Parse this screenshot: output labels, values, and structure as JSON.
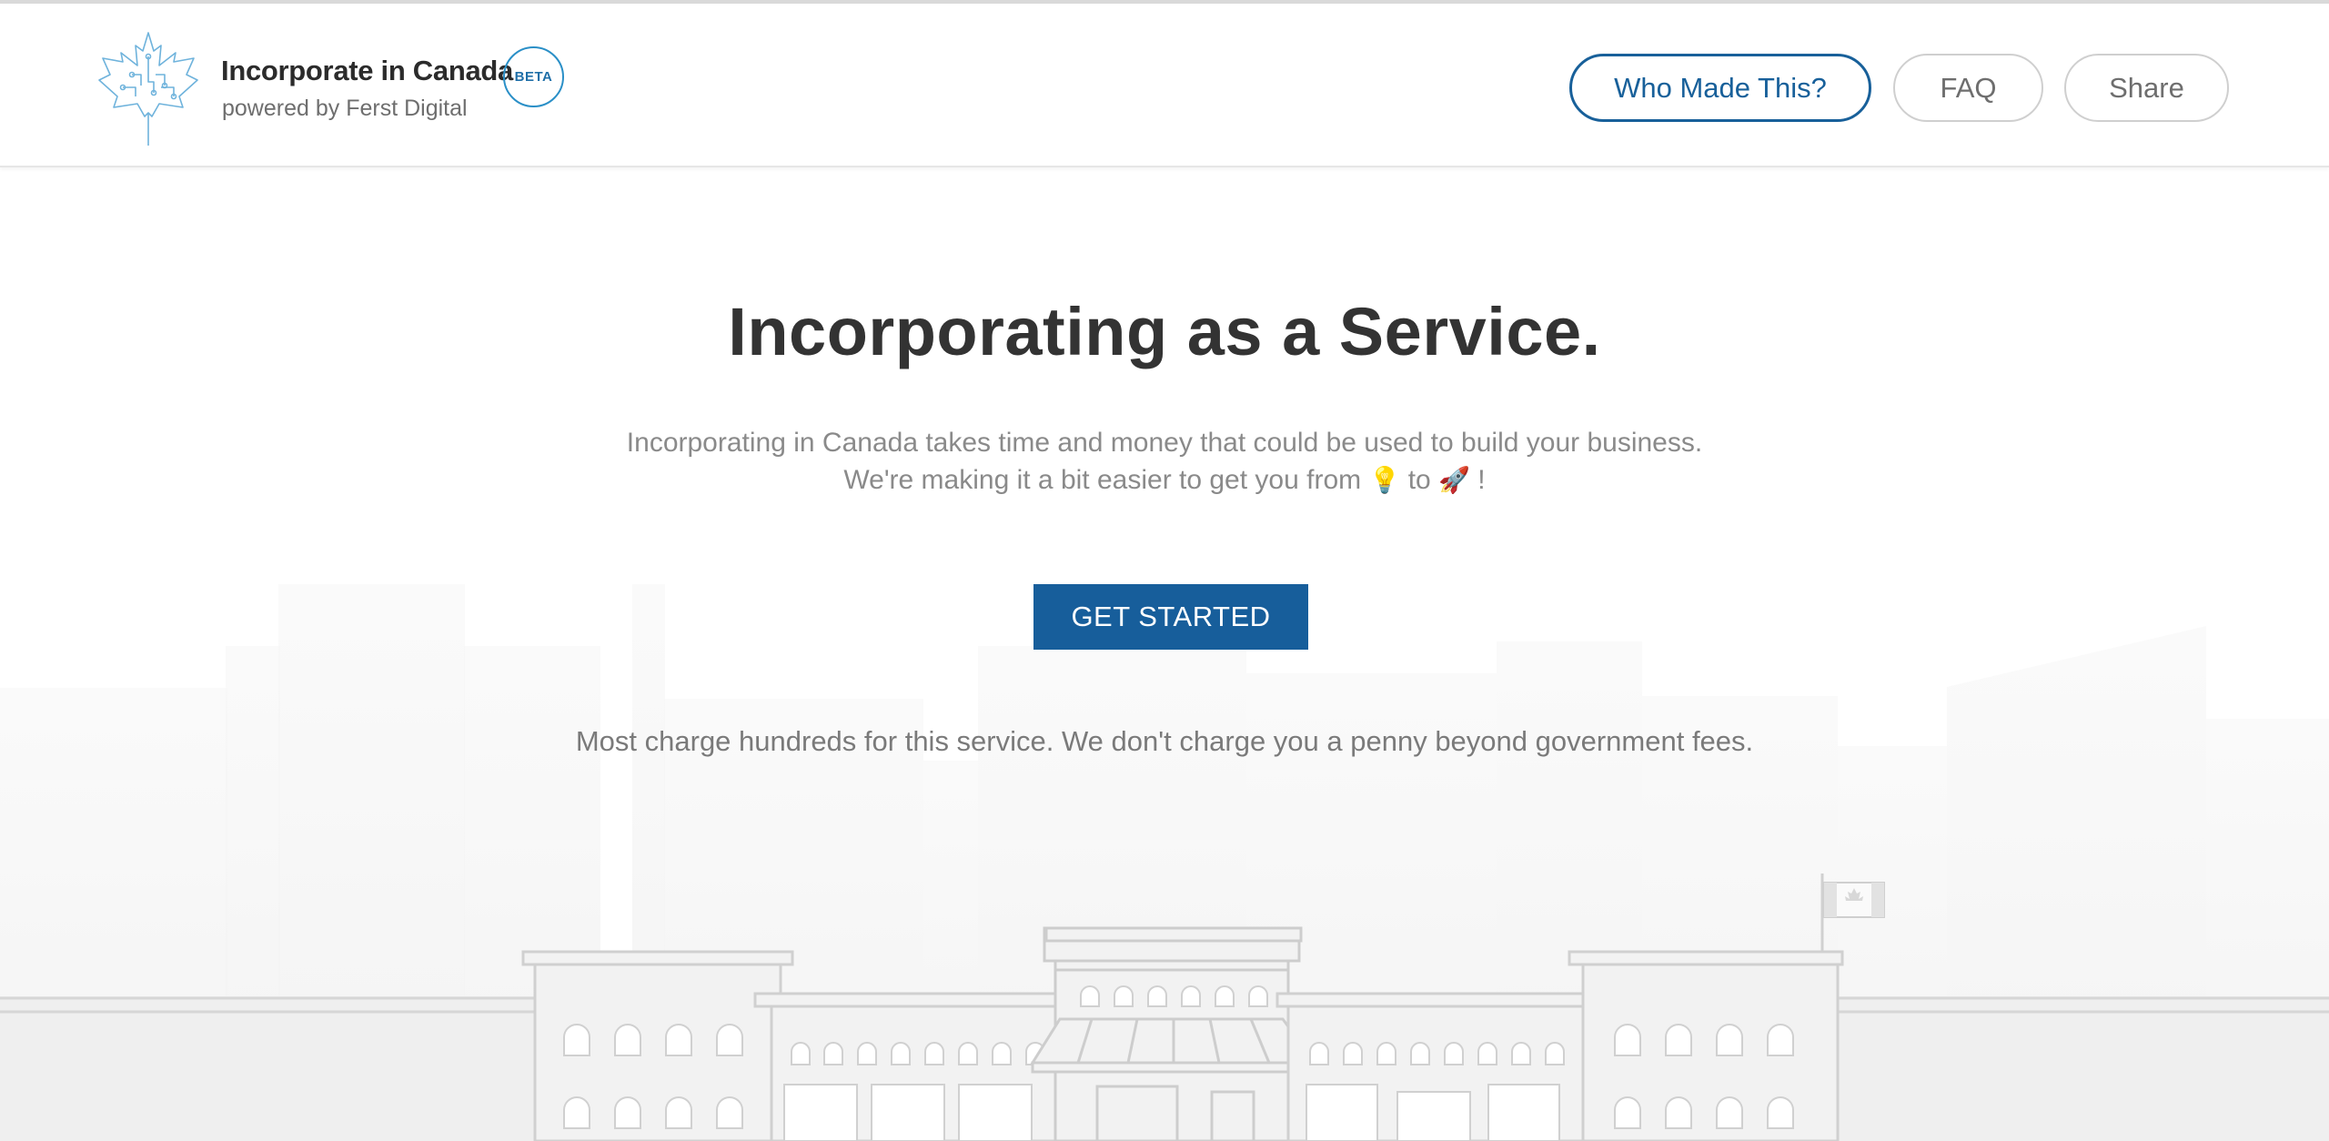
{
  "header": {
    "brand_title": "Incorporate in Canada",
    "brand_subtitle": "powered by Ferst Digital",
    "beta_label": "BETA",
    "nav": {
      "who_made_label": "Who Made This?",
      "faq_label": "FAQ",
      "share_label": "Share"
    }
  },
  "hero": {
    "title": "Incorporating as a Service.",
    "subtitle_line1": "Incorporating in Canada takes time and money that could be used to build your business.",
    "subtitle_line2_prefix": "We're making it a bit easier to get you from",
    "subtitle_line2_mid": "to",
    "subtitle_line2_suffix": "!",
    "idea_icon_glyph": "💡",
    "rocket_icon_glyph": "🚀",
    "cta_label": "GET STARTED",
    "fees_note": "Most charge hundreds for this service. We don't charge you a penny beyond government fees."
  },
  "icons": {
    "logo": "maple-leaf-circuit-icon",
    "idea": "lightbulb-icon",
    "rocket": "rocket-icon",
    "flag": "canada-flag-icon"
  },
  "colors": {
    "accent": "#175e9b",
    "beta_border": "#2a8fc7",
    "text_dark": "#333333",
    "text_muted": "#8a8a8a"
  }
}
